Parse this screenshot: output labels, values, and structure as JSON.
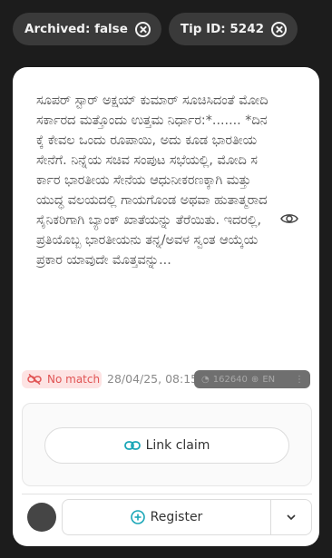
{
  "filters": [
    {
      "label": "Archived: false",
      "icon": "close-circle-icon"
    },
    {
      "label": "Tip ID: 5242",
      "icon": "close-circle-icon"
    }
  ],
  "tip": {
    "text": "ಸೂಪರ್ ಸ್ಟಾರ್ ಅಕ್ಷಯ್ ಕುಮಾರ್ ಸೂಚಿಸಿದಂತೆ ಮೋದಿ ಸರ್ಕಾರದ ಮತ್ತೊಂದು ಉತ್ತಮ ನಿರ್ಧಾರ:*....... *ದಿನಕ್ಕೆ ಕೇವಲ ಒಂದು ರೂಪಾಯಿ, ಅದು ಕೂಡ ಭಾರತೀಯ ಸೇನೆಗೆ. ನಿನ್ನೆಯ ಸಚಿವ ಸಂಪುಟ ಸಭೆಯಲ್ಲಿ, ಮೋದಿ ಸರ್ಕಾರ ಭಾರತೀಯ ಸೇನೆಯ ಆಧುನೀಕರಣಕ್ಕಾಗಿ ಮತ್ತು ಯುದ್ಧ ವಲಯದಲ್ಲಿ ಗಾಯಗೊಂಡ ಅಥವಾ ಹುತಾತ್ಮರಾದ ಸೈನಿಕರಿಗಾಗಿ ಬ್ಯಾಂಕ್ ಖಾತೆಯನ್ನು ತೆರೆಯಿತು. ಇದರಲ್ಲಿ, ಪ್ರತಿಯೊಬ್ಬ ಭಾರತೀಯನು ತನ್ನ/ಅವಳ ಸ್ವಂತ ಆಯ್ಕೆಯ ಪ್ರಕಾರ ಯಾವುದೇ ಮೊತ್ತವನ್ನು...",
    "status": "No match",
    "date": "28/04/25, 08:15",
    "count": "162640",
    "language": "EN"
  },
  "actions": {
    "link_claim": "Link claim",
    "register": "Register"
  },
  "colors": {
    "accent": "#1aa6b7",
    "no_match_bg": "#fde3e3",
    "no_match_fg": "#e05454"
  }
}
